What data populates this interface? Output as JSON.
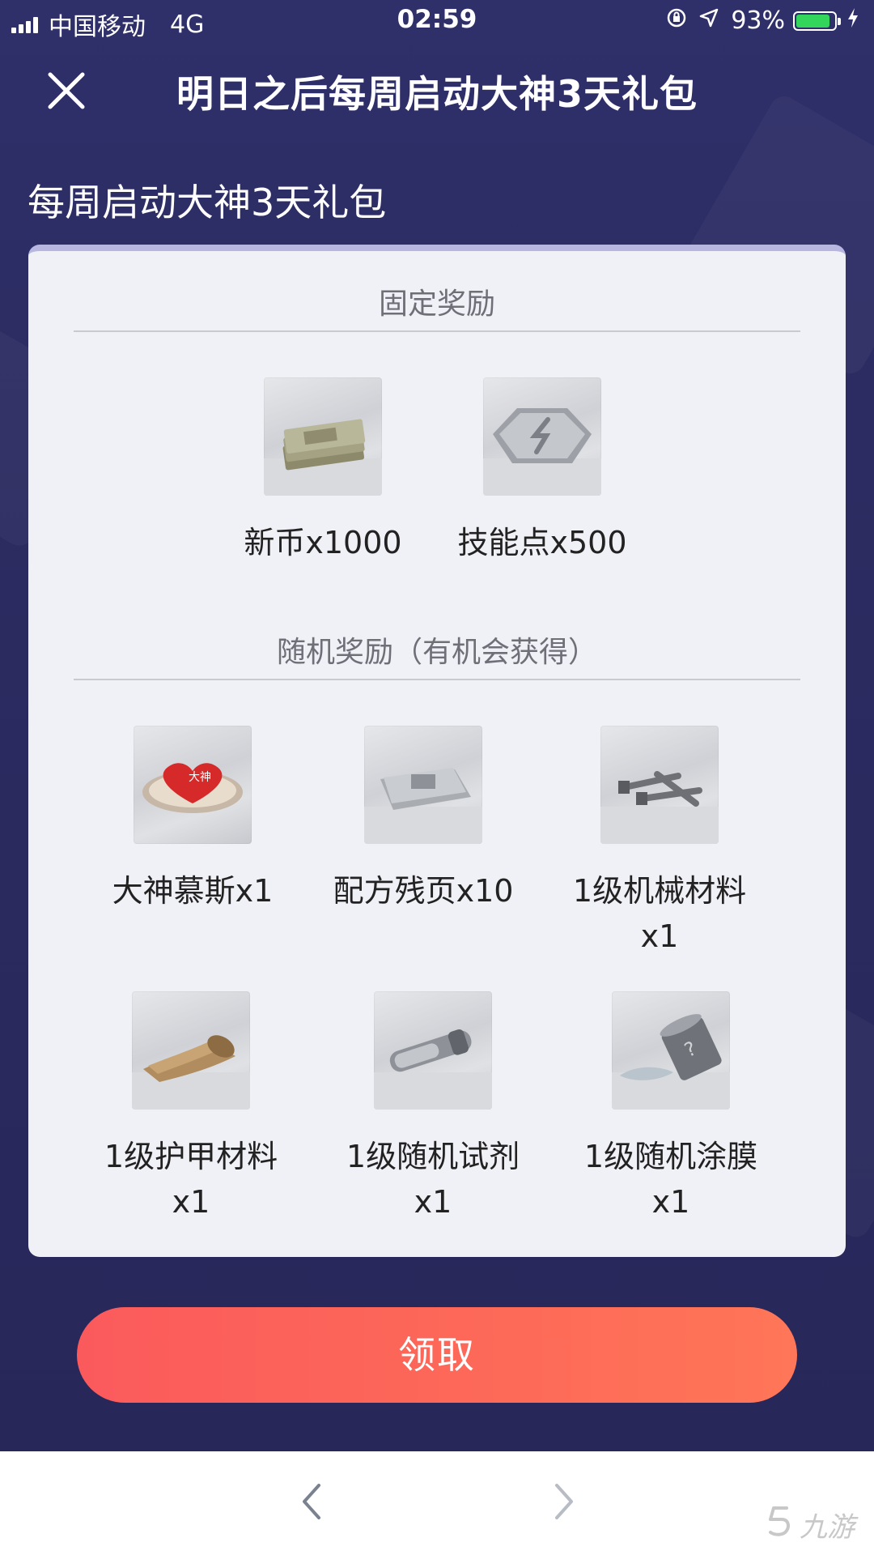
{
  "status_bar": {
    "carrier": "中国移动",
    "network": "4G",
    "time": "02:59",
    "battery": "93%",
    "icons": [
      "signal-icon",
      "rotation-lock-icon",
      "location-icon",
      "battery-icon",
      "charging-icon"
    ],
    "battery_color": "#33d65b"
  },
  "header": {
    "title": "明日之后每周启动大神3天礼包",
    "close_icon": "close-icon"
  },
  "section_title": "每周启动大神3天礼包",
  "fixed_rewards": {
    "heading": "固定奖励",
    "items": [
      {
        "label": "新币x1000",
        "icon": "cash-stack-icon"
      },
      {
        "label": "技能点x500",
        "icon": "skill-token-icon"
      }
    ]
  },
  "random_rewards": {
    "heading": "随机奖励（有机会获得）",
    "items": [
      {
        "label": "大神慕斯x1",
        "icon": "heart-mousse-icon"
      },
      {
        "label": "配方残页x10",
        "icon": "recipe-page-icon"
      },
      {
        "label_line1": "1级机械材料",
        "label_line2": "x1",
        "icon": "mechanical-bolts-icon"
      },
      {
        "label_line1": "1级护甲材料",
        "label_line2": "x1",
        "icon": "armor-cloth-icon"
      },
      {
        "label_line1": "1级随机试剂",
        "label_line2": "x1",
        "icon": "reagent-tube-icon"
      },
      {
        "label_line1": "1级随机涂膜",
        "label_line2": "x1",
        "icon": "paint-can-icon"
      }
    ]
  },
  "claim_button": {
    "label": "领取",
    "color": "#fd6a58"
  },
  "bottom_nav": {
    "back_icon": "chevron-left-icon",
    "forward_icon": "chevron-right-icon",
    "watermark": "九游"
  },
  "colors": {
    "background": "#2c2c62",
    "card": "#f0f0f7",
    "card_accent": "#b7b6e0"
  }
}
